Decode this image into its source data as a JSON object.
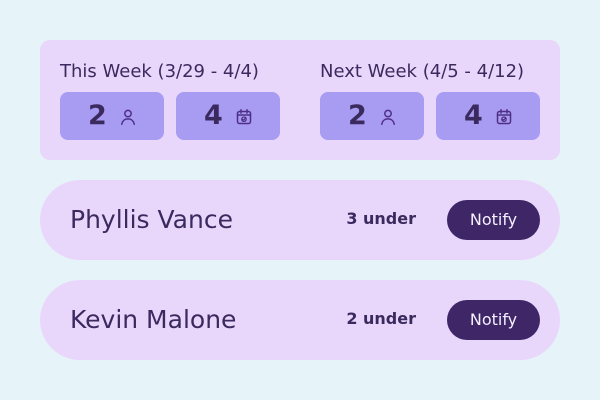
{
  "colors": {
    "page_background": "#e6f3f8",
    "panel_background": "#e8d7fb",
    "chip_background": "#a89bf2",
    "button_background": "#3f2667",
    "button_text": "#f5f0ff",
    "text": "#3b2a5e",
    "icon": "#4f2f86"
  },
  "weeks": [
    {
      "label": "This Week (3/29 - 4/4)",
      "stats": [
        {
          "value": "2",
          "icon": "person-icon"
        },
        {
          "value": "4",
          "icon": "calendar-icon"
        }
      ]
    },
    {
      "label": "Next Week (4/5 - 4/12)",
      "stats": [
        {
          "value": "2",
          "icon": "person-icon"
        },
        {
          "value": "4",
          "icon": "calendar-icon"
        }
      ]
    }
  ],
  "people": [
    {
      "name": "Phyllis Vance",
      "under_count": "3 under",
      "action_label": "Notify"
    },
    {
      "name": "Kevin Malone",
      "under_count": "2 under",
      "action_label": "Notify"
    }
  ]
}
